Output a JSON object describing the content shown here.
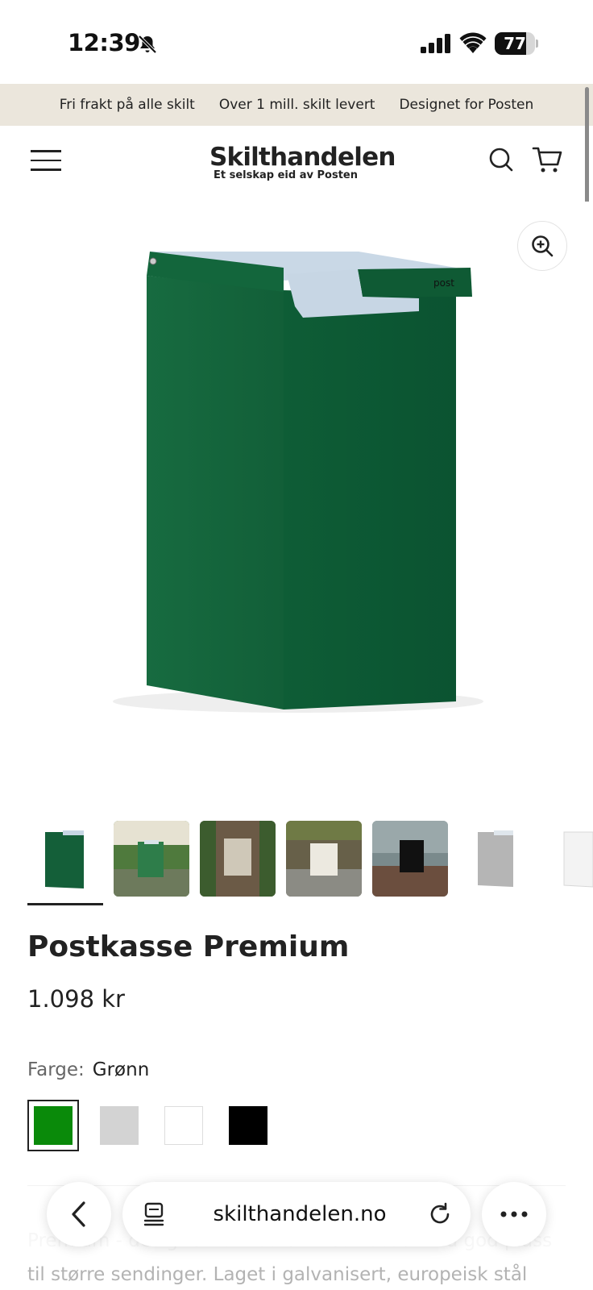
{
  "status_bar": {
    "time": "12:39",
    "battery": "77",
    "battery_level": 0.77
  },
  "announcement": [
    "Fri frakt på alle skilt",
    "Over 1 mill. skilt levert",
    "Designet for Posten"
  ],
  "header": {
    "logo_name": "Skilthandelen",
    "logo_tagline": "Et selskap eid av Posten"
  },
  "product_image": {
    "lid_text": "post"
  },
  "thumbnails": [
    {
      "desc": "green mailbox studio",
      "color": "#1c5e3c"
    },
    {
      "desc": "green mailbox garden",
      "color": "#2f6b3f"
    },
    {
      "desc": "beige mailbox on tree",
      "color": "#c9c2b3"
    },
    {
      "desc": "white mailbox on wall",
      "color": "#e9e6dd"
    },
    {
      "desc": "black mailbox by sea",
      "color": "#111111"
    },
    {
      "desc": "grey mailbox studio",
      "color": "#b8b8b8"
    },
    {
      "desc": "white mailbox studio",
      "color": "#f2f2f2"
    }
  ],
  "product": {
    "title": "Postkasse Premium",
    "price": "1.098 kr",
    "color_label": "Farge:",
    "color_value": "Grønn",
    "swatches": [
      {
        "name": "Grønn",
        "color": "#0a8a0a",
        "selected": true
      },
      {
        "name": "Grå",
        "color": "#d3d3d3",
        "selected": false
      },
      {
        "name": "Hvit",
        "color": "#ffffff",
        "selected": false
      },
      {
        "name": "Svart",
        "color": "#000000",
        "selected": false
      }
    ],
    "description": "Premium - designet for Posten. Postkasse med god plass til større sendinger. Laget i galvanisert, europeisk stål"
  },
  "browser": {
    "url": "skilthandelen.no"
  },
  "colors": {
    "announcement_bg": "#ebe6dc",
    "mailbox_green": "#0f5a34",
    "mailbox_lid": "#c7d6e4"
  }
}
